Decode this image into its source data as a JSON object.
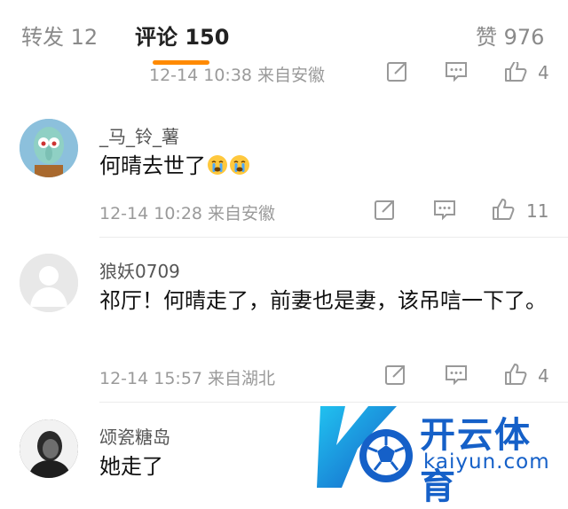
{
  "tabs": {
    "repost": "转发 12",
    "comments": "评论 150",
    "likes": "赞 976"
  },
  "partial": {
    "meta": "12-14 10:38 来自安徽",
    "like_count": "4"
  },
  "comments": [
    {
      "name": "_马_铃_薯",
      "text": "何晴去世了",
      "meta": "12-14 10:28 来自安徽",
      "like_count": "11"
    },
    {
      "name": "狼妖0709",
      "text": "祁厅！何晴走了，前妻也是妻，该吊唁一下了。",
      "meta": "12-14 15:57 来自湖北",
      "like_count": "4"
    },
    {
      "name": "颂瓷糖岛",
      "text": "她走了"
    }
  ],
  "watermark": {
    "name": "开云体育",
    "url": "kaiyun.com"
  },
  "colors": {
    "accent": "#ff8a00",
    "brand": "#1560c8"
  },
  "icons": [
    "share-icon",
    "comment-icon",
    "like-icon",
    "crying-emoji-icon"
  ]
}
